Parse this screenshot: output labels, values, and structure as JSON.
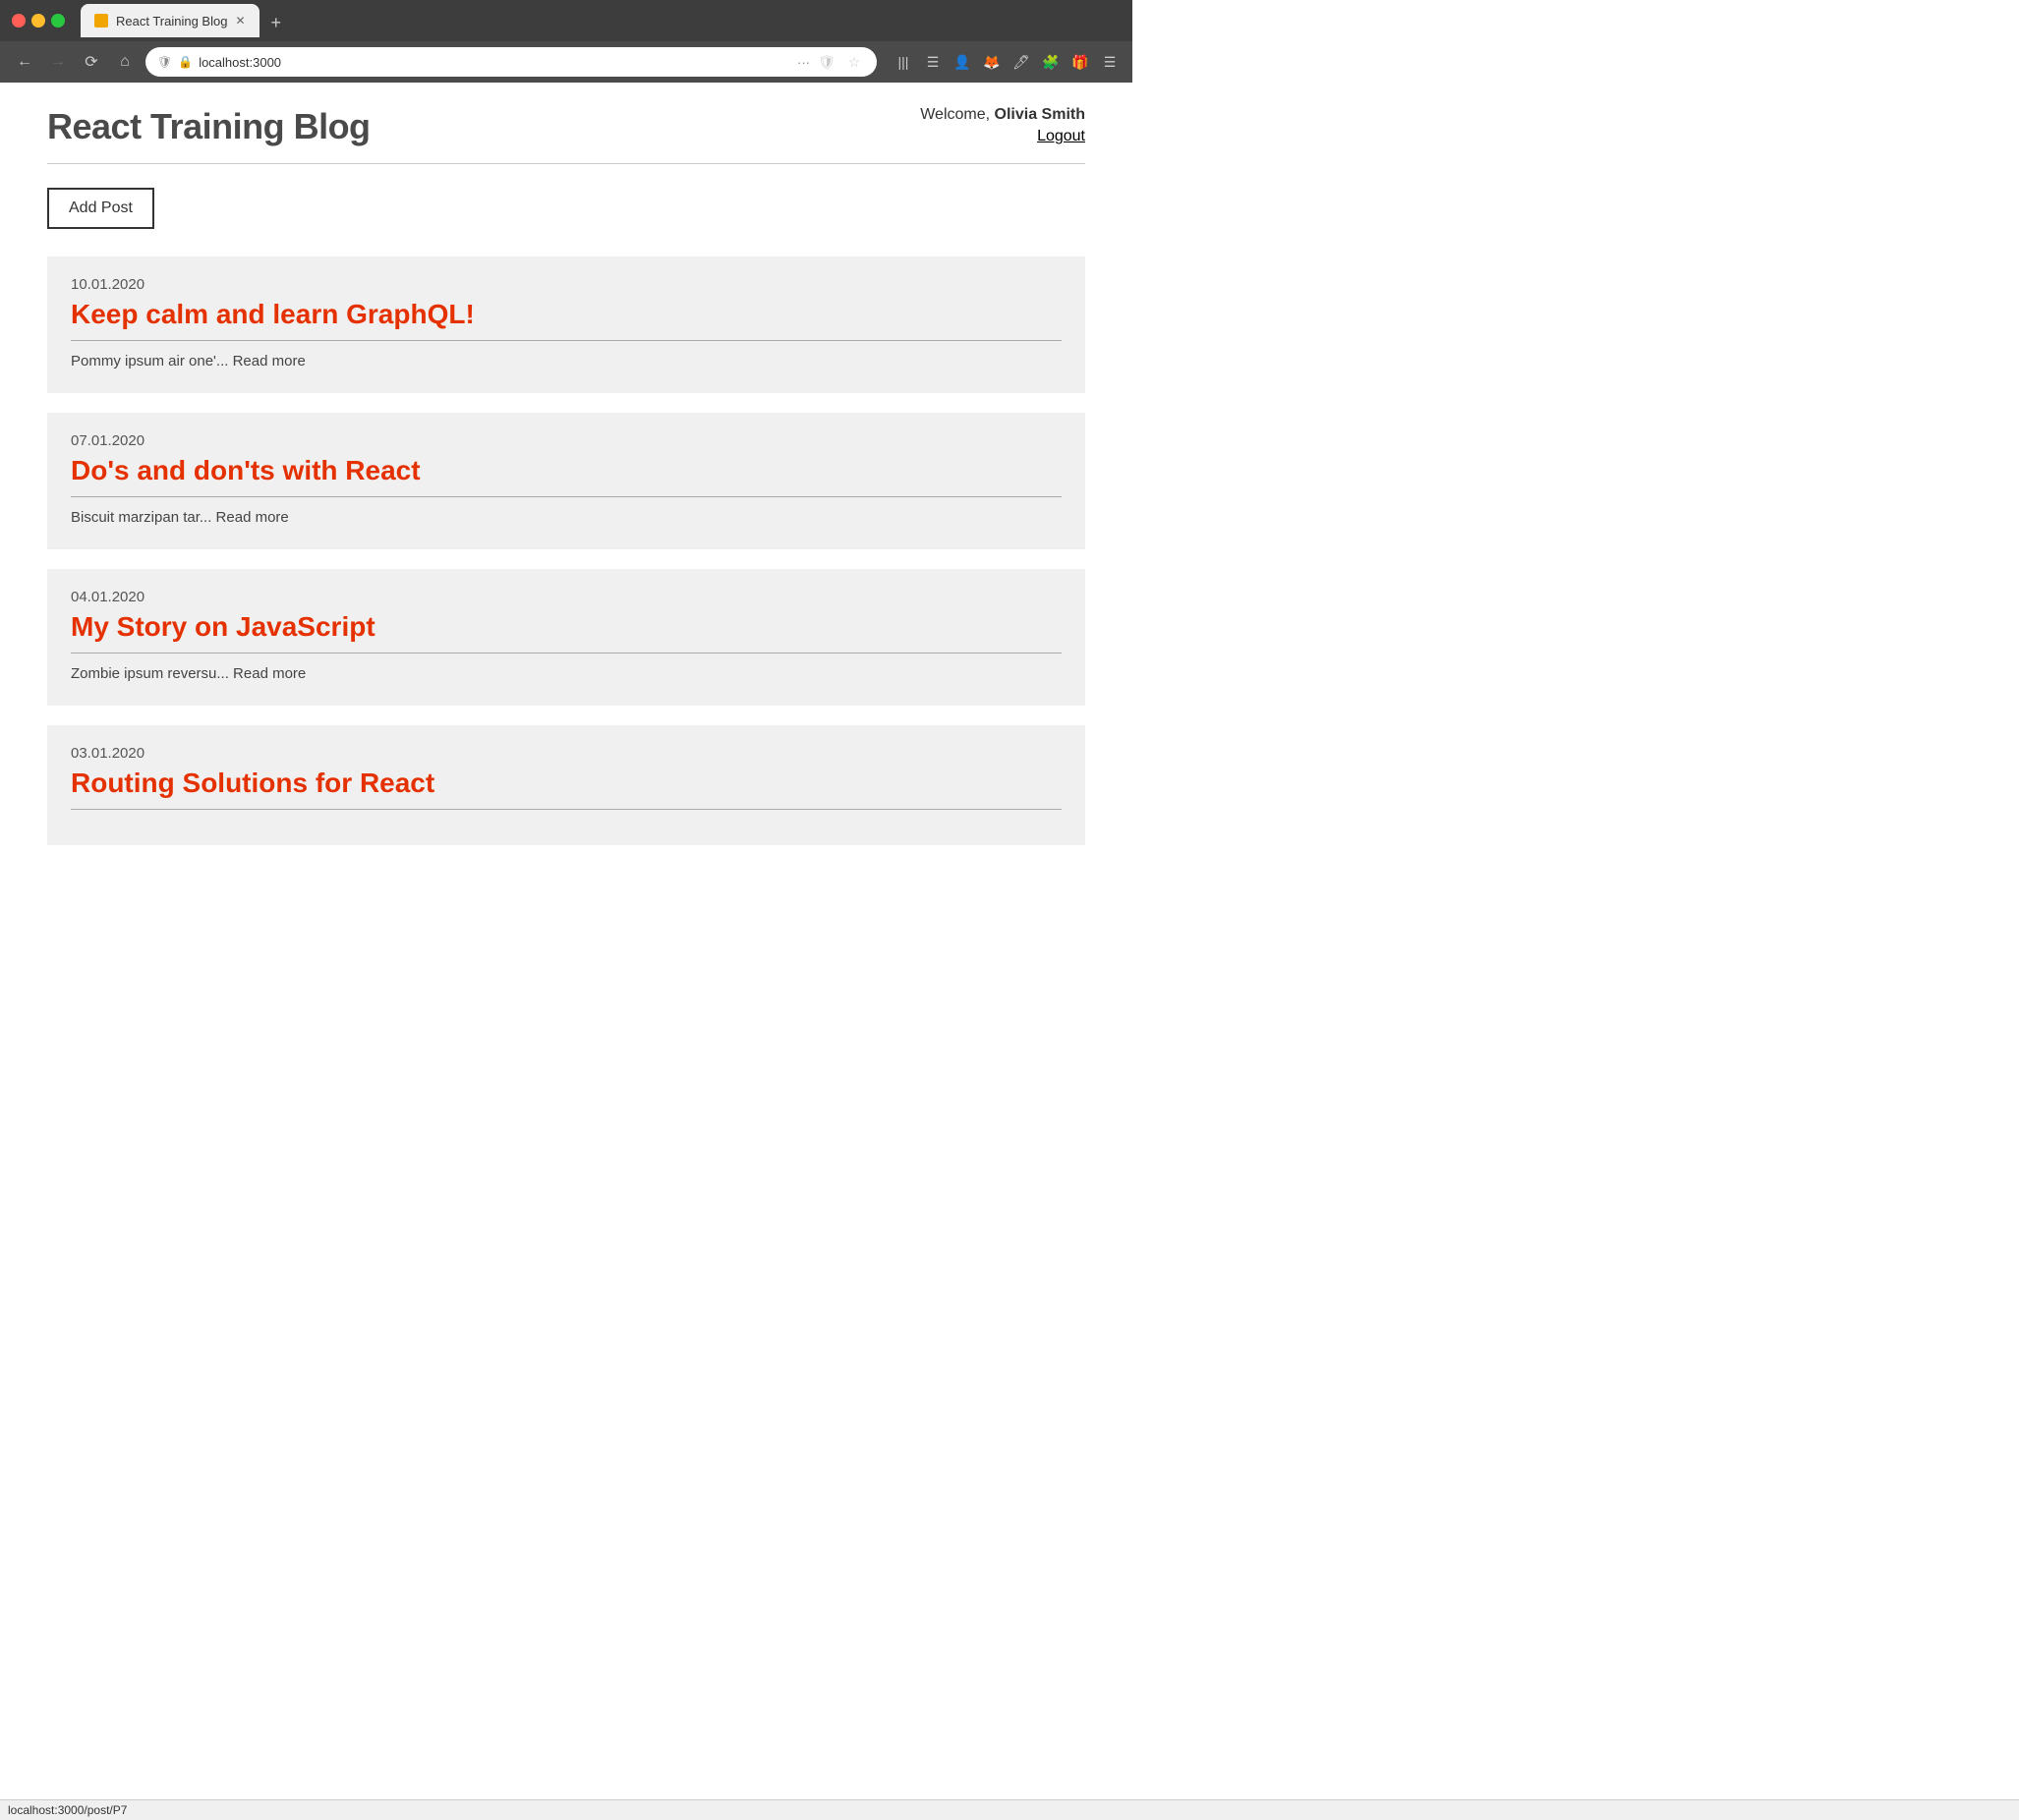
{
  "browser": {
    "tab_title": "React Training Blog",
    "url": "localhost:3000",
    "status_url": "localhost:3000/post/P7",
    "new_tab_label": "+"
  },
  "header": {
    "site_title": "React Training Blog",
    "welcome_text": "Welcome,",
    "user_name": "Olivia Smith",
    "logout_label": "Logout"
  },
  "toolbar": {
    "add_post_label": "Add Post"
  },
  "posts": [
    {
      "date": "10.01.2020",
      "title": "Keep calm and learn GraphQL!",
      "excerpt": "Pommy ipsum air one'... Read more"
    },
    {
      "date": "07.01.2020",
      "title": "Do's and don'ts with React",
      "excerpt": "Biscuit marzipan tar... Read more"
    },
    {
      "date": "04.01.2020",
      "title": "My Story on JavaScript",
      "excerpt": "Zombie ipsum reversu... Read more"
    },
    {
      "date": "03.01.2020",
      "title": "Routing Solutions for React",
      "excerpt": ""
    }
  ],
  "colors": {
    "post_title": "#e53000",
    "site_title": "#4a4a4a"
  }
}
